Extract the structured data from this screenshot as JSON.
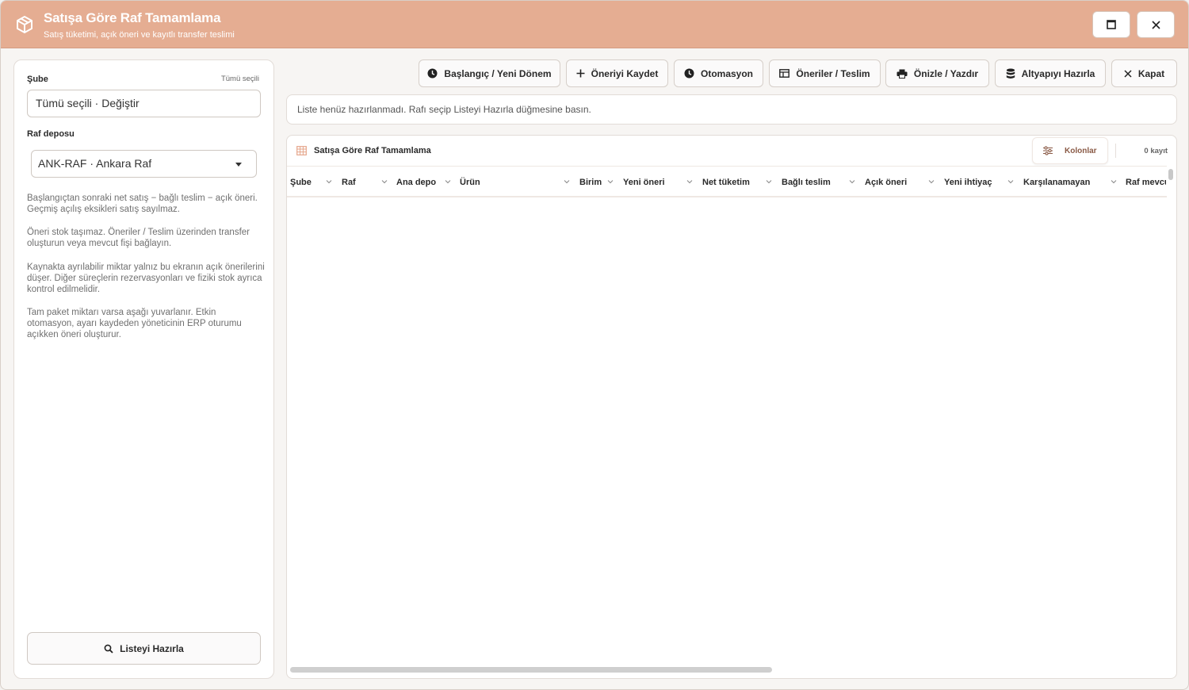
{
  "window": {
    "title": "Satışa Göre Raf Tamamlama",
    "subtitle": "Satış tüketimi, açık öneri ve kayıtlı transfer teslimi",
    "maximize_icon": "maximize-icon",
    "close_icon": "close-icon"
  },
  "left_panel": {
    "branch_label": "Şube",
    "branch_hint": "Tümü seçili",
    "branch_value": "Tümü seçili · Değiştir",
    "shelf_label": "Raf deposu",
    "shelf_selected": "ANK-RAF · Ankara Raf",
    "info": [
      "Başlangıçtan sonraki net satış − bağlı teslim − açık öneri. Geçmiş açılış eksikleri satış sayılmaz.",
      "Öneri stok taşımaz. Öneriler / Teslim üzerinden transfer oluşturun veya mevcut fişi bağlayın.",
      "Kaynakta ayrılabilir miktar yalnız bu ekranın açık önerilerini düşer. Diğer süreçlerin rezervasyonları ve fiziki stok ayrıca kontrol edilmelidir.",
      "Tam paket miktarı varsa aşağı yuvarlanır. Etkin otomasyon, ayarı kaydeden yöneticinin ERP oturumu açıkken öneri oluşturur."
    ],
    "prepare_button": "Listeyi Hazırla"
  },
  "toolbar": {
    "buttons": [
      {
        "label": "Başlangıç / Yeni Dönem",
        "icon": "clock-icon"
      },
      {
        "label": "Öneriyi Kaydet",
        "icon": "plus-icon"
      },
      {
        "label": "Otomasyon",
        "icon": "clock-icon"
      },
      {
        "label": "Öneriler / Teslim",
        "icon": "table-icon"
      },
      {
        "label": "Önizle / Yazdır",
        "icon": "printer-icon"
      },
      {
        "label": "Altyapıyı Hazırla",
        "icon": "database-icon"
      },
      {
        "label": "Kapat",
        "icon": "close-icon"
      }
    ]
  },
  "status": "Liste henüz hazırlanmadı. Rafı seçip Listeyi Hazırla düğmesine basın.",
  "grid": {
    "title": "Satışa Göre Raf Tamamlama",
    "columns_button": "Kolonlar",
    "count": "0 kayıt",
    "columns": [
      "Şube",
      "Raf",
      "Ana depo",
      "Ürün",
      "Birim",
      "Yeni öneri",
      "Net tüketim",
      "Bağlı teslim",
      "Açık öneri",
      "Yeni ihtiyaç",
      "Karşılanamayan",
      "Raf mevcut"
    ],
    "rows": []
  },
  "colors": {
    "titlebar": "#e5ad92",
    "accent_text": "#8a5a46"
  }
}
